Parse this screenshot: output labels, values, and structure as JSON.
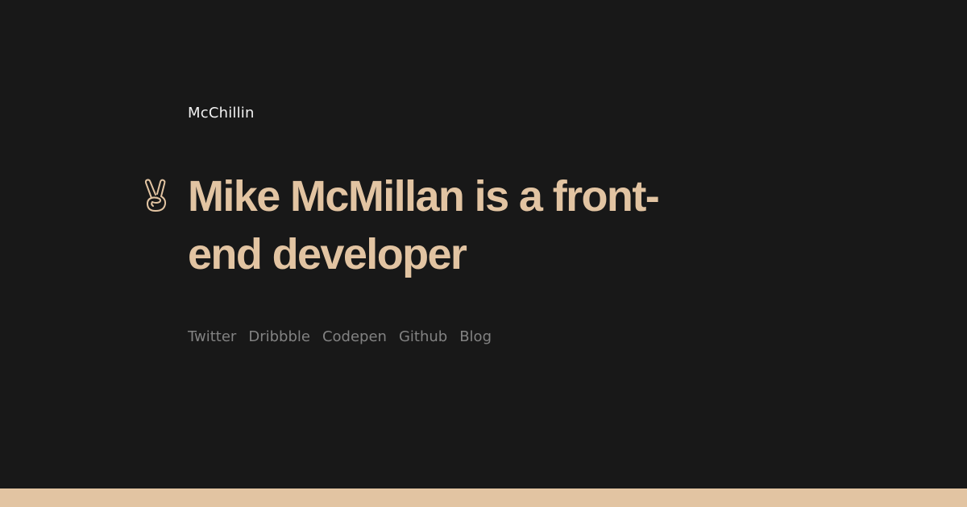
{
  "site": {
    "name": "McChillin"
  },
  "hero": {
    "icon": "victory-hand-icon",
    "headline": "Mike McMillan is a front-end developer"
  },
  "social": {
    "links": [
      {
        "label": "Twitter"
      },
      {
        "label": "Dribbble"
      },
      {
        "label": "Codepen"
      },
      {
        "label": "Github"
      },
      {
        "label": "Blog"
      }
    ]
  },
  "colors": {
    "background": "#181818",
    "accent": "#e2c4a2",
    "link": "#828282",
    "site_name": "#f2f2f2"
  }
}
